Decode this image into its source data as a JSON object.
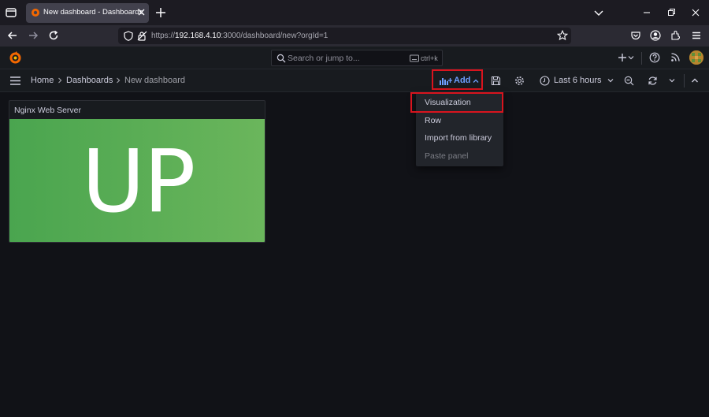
{
  "browser": {
    "tab_title": "New dashboard - Dashboards",
    "url_prefix": "https://",
    "url_host": "192.168.4.10",
    "url_rest": ":3000/dashboard/new?orgId=1"
  },
  "grafana": {
    "search_placeholder": "Search or jump to...",
    "search_shortcut": "ctrl+k"
  },
  "breadcrumb": {
    "home": "Home",
    "dashboards": "Dashboards",
    "current": "New dashboard"
  },
  "toolbar": {
    "add_label": "Add",
    "time_range": "Last 6 hours"
  },
  "add_menu": {
    "items": [
      {
        "label": "Visualization",
        "enabled": true
      },
      {
        "label": "Row",
        "enabled": true
      },
      {
        "label": "Import from library",
        "enabled": true
      },
      {
        "label": "Paste panel",
        "enabled": false
      }
    ]
  },
  "panel": {
    "title": "Nginx Web Server",
    "value": "UP",
    "background_color": "#56ab52"
  },
  "colors": {
    "accent": "#6e9fff",
    "highlight_box": "#d9141e",
    "background": "#111217"
  }
}
